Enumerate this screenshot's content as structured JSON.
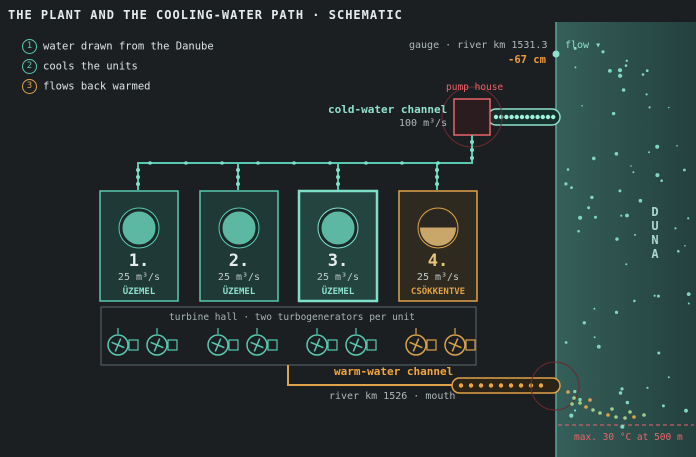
{
  "title": "THE PLANT AND THE COOLING-WATER PATH · SCHEMATIC",
  "legend": [
    {
      "num": "1",
      "text": "water drawn from the Danube",
      "tone": "cold"
    },
    {
      "num": "2",
      "text": "cools the units",
      "tone": "cold"
    },
    {
      "num": "3",
      "text": "flows back warmed",
      "tone": "warm"
    }
  ],
  "gauge": {
    "label": "gauge · river km 1531.3",
    "value": "-67 cm"
  },
  "flow_toggle": "flow ▾",
  "pump_house": "pump house",
  "cold_channel": {
    "label": "cold-water channel",
    "flow": "100 m³/s"
  },
  "units": [
    {
      "num": "1.",
      "flow": "25 m³/s",
      "status": "ÜZEMEL",
      "state": "running"
    },
    {
      "num": "2.",
      "flow": "25 m³/s",
      "status": "ÜZEMEL",
      "state": "running"
    },
    {
      "num": "3.",
      "flow": "25 m³/s",
      "status": "ÜZEMEL",
      "state": "selected"
    },
    {
      "num": "4.",
      "flow": "25 m³/s",
      "status": "CSÖKKENTVE",
      "state": "reduced"
    }
  ],
  "turbine_hall": "turbine hall · two turbogenerators per unit",
  "warm_channel": {
    "label": "warm-water channel",
    "mouth": "river km 1526 · mouth"
  },
  "river": {
    "name": "DUNA",
    "limit": "max. 30 °C at 500 m"
  },
  "colors": {
    "cold": "#58c9b0",
    "warm": "#e0a24a",
    "alert": "#e8656a",
    "river": "#2f5a55",
    "bg": "#1c1f22"
  }
}
